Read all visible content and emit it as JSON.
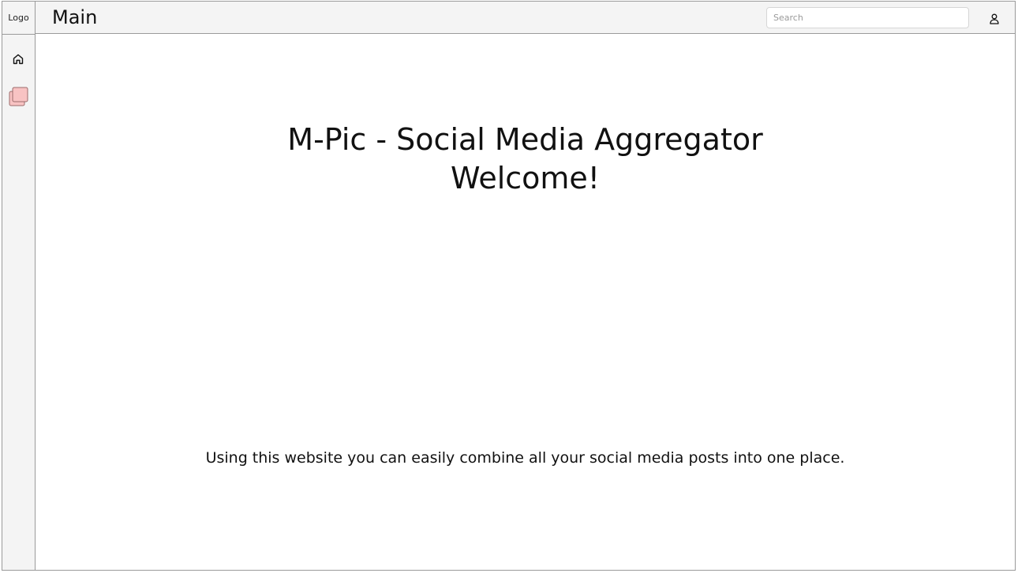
{
  "sidebar": {
    "logo_label": "Logo",
    "items": [
      {
        "icon": "home-icon"
      },
      {
        "icon": "pages-icon",
        "accent": "#f8c3c3"
      }
    ]
  },
  "header": {
    "title": "Main",
    "search": {
      "placeholder": "Search",
      "value": ""
    },
    "user_icon": "user-icon"
  },
  "main": {
    "heading_line1": "M-Pic - Social Media Aggregator",
    "heading_line2": "Welcome!",
    "description": "Using this website you can easily combine all your social media posts into one place."
  },
  "colors": {
    "sidebar_bg": "#f4f4f4",
    "border": "#9a9a9a",
    "accent_pink": "#f8c3c3"
  }
}
